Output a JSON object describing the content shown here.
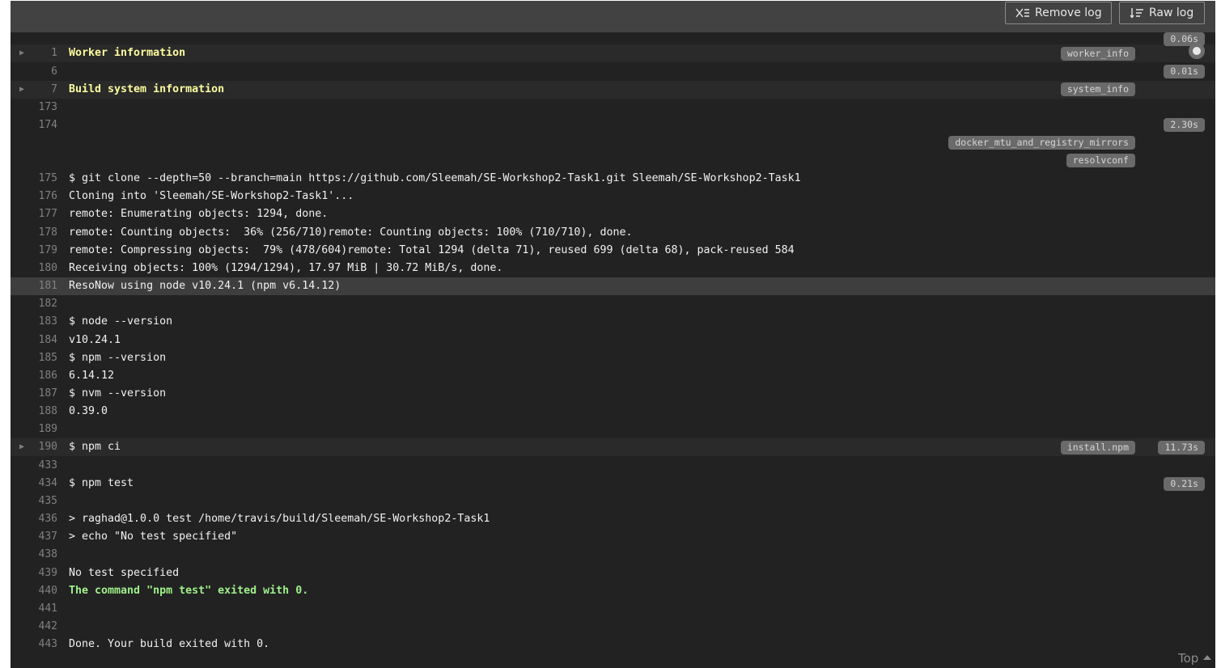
{
  "toolbar": {
    "remove_log_label": "Remove log",
    "raw_log_label": "Raw log"
  },
  "log": {
    "lines": [
      {
        "n": "1",
        "text": "Worker information",
        "fold": true,
        "yellow": true
      },
      {
        "n": "6",
        "text": ""
      },
      {
        "n": "7",
        "text": "Build system information",
        "fold": true,
        "yellow": true
      },
      {
        "n": "173",
        "text": ""
      },
      {
        "n": "174",
        "text": ""
      },
      {
        "n": "175",
        "text": "$ git clone --depth=50 --branch=main https://github.com/Sleemah/SE-Workshop2-Task1.git Sleemah/SE-Workshop2-Task1"
      },
      {
        "n": "176",
        "text": "Cloning into 'Sleemah/SE-Workshop2-Task1'..."
      },
      {
        "n": "177",
        "text": "remote: Enumerating objects: 1294, done."
      },
      {
        "n": "178",
        "text": "remote: Counting objects:  36% (256/710)remote: Counting objects: 100% (710/710), done."
      },
      {
        "n": "179",
        "text": "remote: Compressing objects:  79% (478/604)remote: Total 1294 (delta 71), reused 699 (delta 68), pack-reused 584"
      },
      {
        "n": "180",
        "text": "Receiving objects: 100% (1294/1294), 17.97 MiB | 30.72 MiB/s, done."
      },
      {
        "n": "181",
        "text": "ResoNow using node v10.24.1 (npm v6.14.12)",
        "highlight": true
      },
      {
        "n": "182",
        "text": ""
      },
      {
        "n": "183",
        "text": "$ node --version"
      },
      {
        "n": "184",
        "text": "v10.24.1"
      },
      {
        "n": "185",
        "text": "$ npm --version"
      },
      {
        "n": "186",
        "text": "6.14.12"
      },
      {
        "n": "187",
        "text": "$ nvm --version"
      },
      {
        "n": "188",
        "text": "0.39.0"
      },
      {
        "n": "189",
        "text": ""
      },
      {
        "n": "190",
        "text": "$ npm ci",
        "fold": true
      },
      {
        "n": "433",
        "text": ""
      },
      {
        "n": "434",
        "text": "$ npm test"
      },
      {
        "n": "435",
        "text": ""
      },
      {
        "n": "436",
        "text": "> raghad@1.0.0 test /home/travis/build/Sleemah/SE-Workshop2-Task1"
      },
      {
        "n": "437",
        "text": "> echo \"No test specified\""
      },
      {
        "n": "438",
        "text": ""
      },
      {
        "n": "439",
        "text": "No test specified"
      },
      {
        "n": "440",
        "text": "The command \"npm test\" exited with 0.",
        "green": true
      },
      {
        "n": "441",
        "text": ""
      },
      {
        "n": "442",
        "text": ""
      },
      {
        "n": "443",
        "text": "Done. Your build exited with 0."
      }
    ],
    "fold_tags": {
      "worker_info": "worker_info",
      "system_info": "system_info",
      "docker": "docker_mtu_and_registry_mirrors",
      "resolvconf": "resolvconf",
      "install_npm": "install.npm"
    },
    "durations": {
      "worker": "0.06s",
      "system": "0.01s",
      "docker": "2.30s",
      "install": "11.73s",
      "test": "0.21s"
    }
  },
  "top_link": "Top",
  "icons": {
    "remove": "remove-log-icon",
    "raw": "raw-log-icon",
    "fold": "fold-arrow-icon",
    "top": "caret-up-icon"
  },
  "colors": {
    "background": "#222222",
    "toolbar": "#424242",
    "yellow_text": "#fdfc9f",
    "green_text": "#9ff08a",
    "badge": "#6a6a6a"
  }
}
